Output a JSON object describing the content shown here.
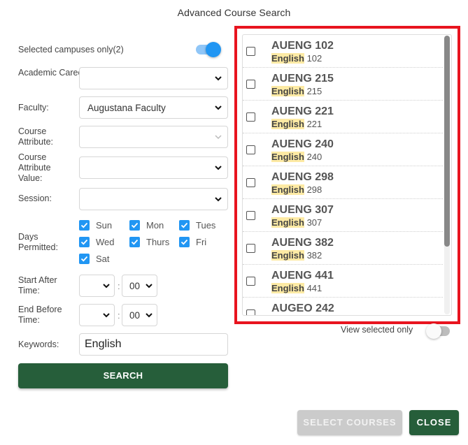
{
  "dialog": {
    "title": "Advanced Course Search"
  },
  "form": {
    "campus_toggle": {
      "label": "Selected campuses only(2)",
      "on": true
    },
    "academic_career": {
      "label": "Academic Career:",
      "value": ""
    },
    "faculty": {
      "label": "Faculty:",
      "value": "Augustana Faculty"
    },
    "course_attribute": {
      "label": "Course Attribute:",
      "value": "",
      "disabled": true
    },
    "course_attribute_value": {
      "label": "Course Attribute Value:",
      "value": ""
    },
    "session": {
      "label": "Session:",
      "value": ""
    },
    "days": {
      "label": "Days Permitted:",
      "options": [
        {
          "label": "Sun",
          "checked": true
        },
        {
          "label": "Mon",
          "checked": true
        },
        {
          "label": "Tues",
          "checked": true
        },
        {
          "label": "Wed",
          "checked": true
        },
        {
          "label": "Thurs",
          "checked": true
        },
        {
          "label": "Fri",
          "checked": true
        },
        {
          "label": "Sat",
          "checked": true
        }
      ]
    },
    "start_after": {
      "label": "Start After Time:",
      "hour": "",
      "separator": ":",
      "minute": "00"
    },
    "end_before": {
      "label": "End Before Time:",
      "hour": "",
      "separator": ":",
      "minute": "00"
    },
    "keywords": {
      "label": "Keywords:",
      "value": "English"
    },
    "search_button": "SEARCH"
  },
  "results": {
    "items": [
      {
        "code": "AUENG 102",
        "highlight": "English",
        "rest": " 102",
        "checked": false
      },
      {
        "code": "AUENG 215",
        "highlight": "English",
        "rest": " 215",
        "checked": false
      },
      {
        "code": "AUENG 221",
        "highlight": "English",
        "rest": " 221",
        "checked": false
      },
      {
        "code": "AUENG 240",
        "highlight": "English",
        "rest": " 240",
        "checked": false
      },
      {
        "code": "AUENG 298",
        "highlight": "English",
        "rest": " 298",
        "checked": false
      },
      {
        "code": "AUENG 307",
        "highlight": "English",
        "rest": " 307",
        "checked": false
      },
      {
        "code": "AUENG 382",
        "highlight": "English",
        "rest": " 382",
        "checked": false
      },
      {
        "code": "AUENG 441",
        "highlight": "English",
        "rest": " 441",
        "checked": false
      },
      {
        "code": "AUGEO 242",
        "highlight": "",
        "rest": "",
        "checked": false
      }
    ],
    "view_selected_only": {
      "label": "View selected only",
      "on": false
    }
  },
  "footer": {
    "select_courses": "SELECT COURSES",
    "close": "CLOSE"
  },
  "colors": {
    "primary_green": "#265e3a",
    "accent_blue": "#2196f3",
    "highlight_red": "#e8141f",
    "keyword_highlight": "#fdeaa4",
    "disabled_button": "#cbcbcb"
  }
}
